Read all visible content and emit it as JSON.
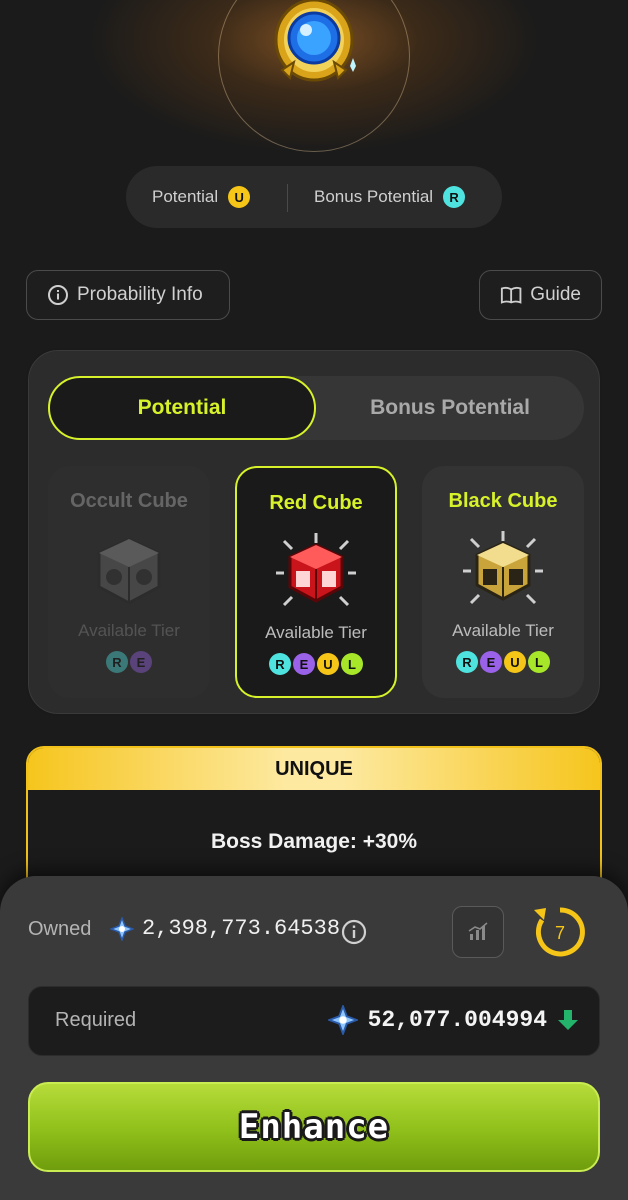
{
  "hero": {
    "item_icon": "blue-orb-pendant-icon"
  },
  "potential_summary": {
    "potential_label": "Potential",
    "potential_tier": "U",
    "potential_tier_color": "#f5c518",
    "bonus_label": "Bonus Potential",
    "bonus_tier": "R",
    "bonus_tier_color": "#4fe3e0"
  },
  "actions": {
    "probability_info": "Probability Info",
    "guide": "Guide"
  },
  "tabs": [
    {
      "label": "Potential",
      "active": true
    },
    {
      "label": "Bonus Potential",
      "active": false
    }
  ],
  "available_tier_label": "Available Tier",
  "tier_colors": {
    "R": "#4fe3e0",
    "E": "#9a62e8",
    "U": "#f5c518",
    "L": "#a8e62a"
  },
  "cubes": [
    {
      "name": "Occult Cube",
      "icon": "occult-cube-icon",
      "tiers": [
        "R",
        "E"
      ],
      "state": "disabled"
    },
    {
      "name": "Red Cube",
      "icon": "red-cube-icon",
      "tiers": [
        "R",
        "E",
        "U",
        "L"
      ],
      "state": "selected"
    },
    {
      "name": "Black Cube",
      "icon": "black-cube-icon",
      "tiers": [
        "R",
        "E",
        "U",
        "L"
      ],
      "state": "available"
    }
  ],
  "result": {
    "rank": "UNIQUE",
    "line1": "Boss Damage: +30%"
  },
  "cost": {
    "owned_label": "Owned",
    "owned_value": "2,398,773.64538",
    "required_label": "Required",
    "required_value": "52,077.004994",
    "currency_icon": "blue-crystal-icon",
    "auto_count": "7"
  },
  "enhance_label": "Enhance",
  "accent_color": "#d7f22a"
}
